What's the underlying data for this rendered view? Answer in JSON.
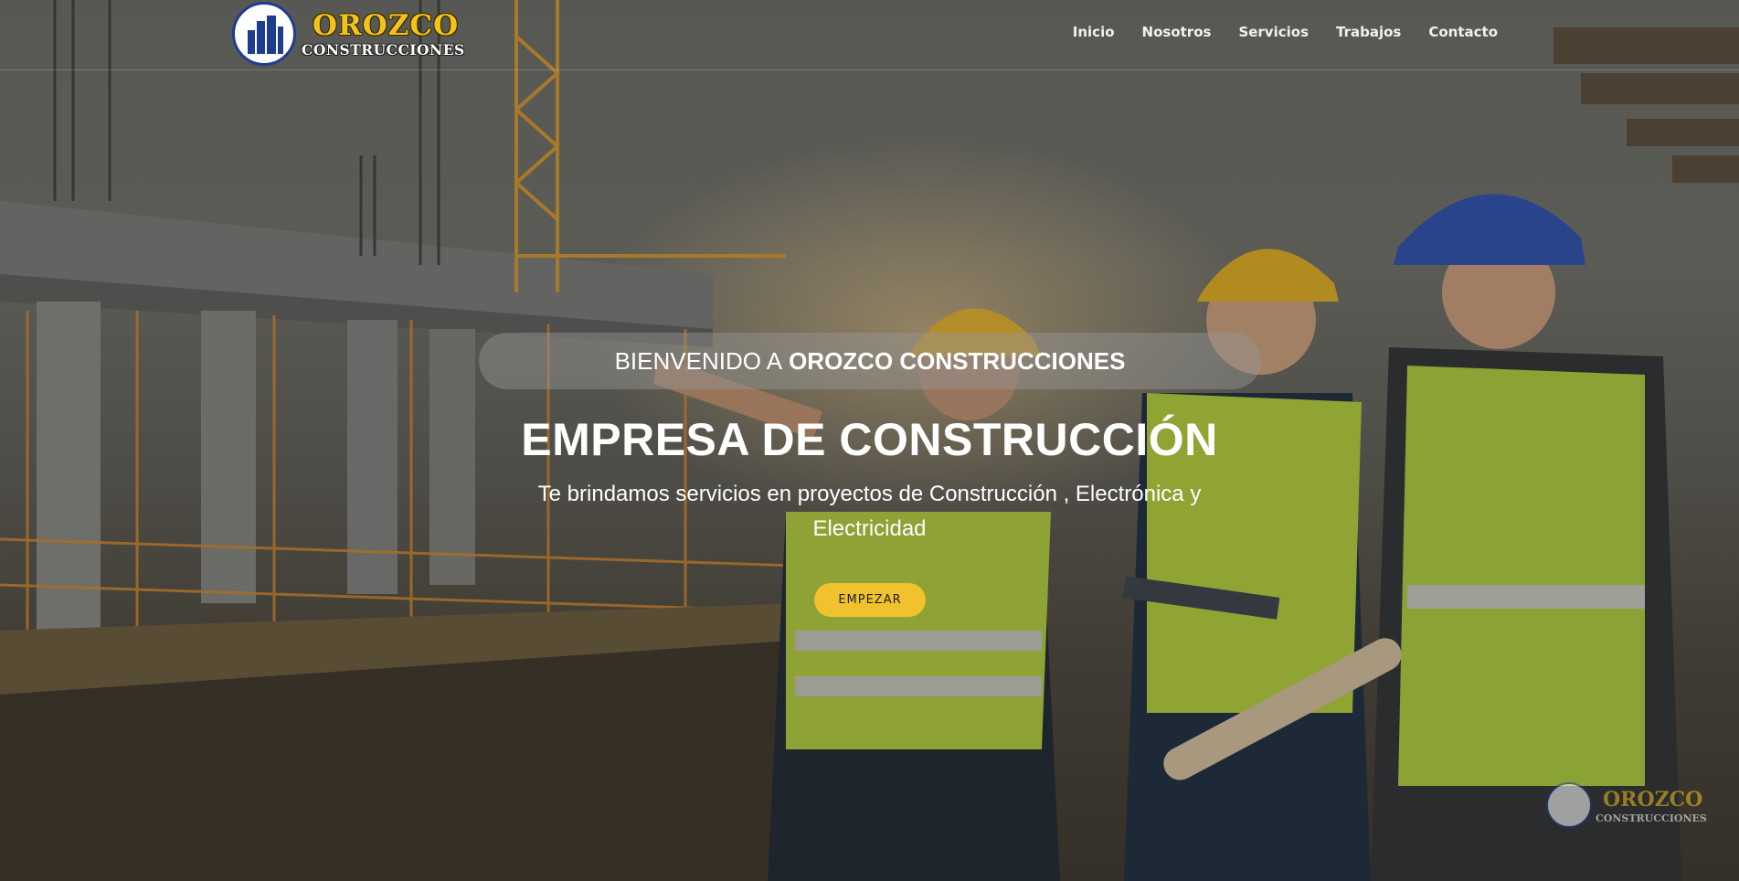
{
  "brand": {
    "name": "OROZCO",
    "tagline": "CONSTRUCCIONES",
    "logo_icon": "building-logo-icon",
    "accent_color": "#f3c21b",
    "logo_blue": "#1f3d8f"
  },
  "nav": {
    "items": [
      {
        "label": "Inicio"
      },
      {
        "label": "Nosotros"
      },
      {
        "label": "Servicios"
      },
      {
        "label": "Trabajos"
      },
      {
        "label": "Contacto"
      }
    ]
  },
  "hero": {
    "welcome_prefix": "BIENVENIDO A",
    "welcome_brand": "OROZCO CONSTRUCCIONES",
    "title": "EMPRESA DE CONSTRUCCIÓN",
    "subtitle": "Te brindamos servicios en proyectos de Construcción , Electrónica y Electricidad",
    "cta_label": "EMPEZAR",
    "cta_color": "#f2c12e"
  },
  "watermark": {
    "name": "OROZCO",
    "tagline": "CONSTRUCCIONES"
  }
}
